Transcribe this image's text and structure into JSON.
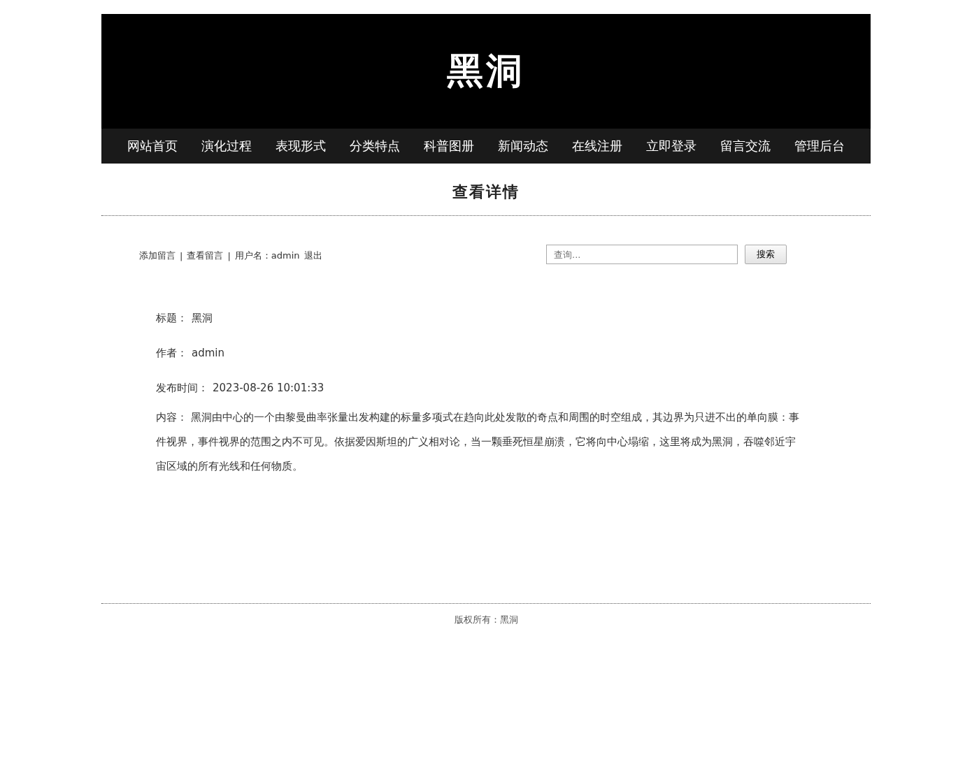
{
  "site_title": "黑洞",
  "nav": [
    {
      "label": "网站首页",
      "selected": false
    },
    {
      "label": "演化过程",
      "selected": false
    },
    {
      "label": "表现形式",
      "selected": false
    },
    {
      "label": "分类特点",
      "selected": false
    },
    {
      "label": "科普图册",
      "selected": false
    },
    {
      "label": "新闻动态",
      "selected": false
    },
    {
      "label": "在线注册",
      "selected": false
    },
    {
      "label": "立即登录",
      "selected": false
    },
    {
      "label": "留言交流",
      "selected": false
    },
    {
      "label": "管理后台",
      "selected": false
    }
  ],
  "page_heading": "查看详情",
  "toolbar": {
    "links": [
      "添加留言",
      "查看留言"
    ],
    "separator": "|",
    "user_label": "用户名：admin",
    "logout": "退出"
  },
  "search": {
    "placeholder": "查询...",
    "button": "搜索"
  },
  "details": [
    {
      "label": "标题：",
      "value": "黑洞"
    },
    {
      "label": "作者：",
      "value": "admin"
    },
    {
      "label": "发布时间：",
      "value": "2023-08-26 10:01:33"
    }
  ],
  "content": {
    "label": "内容：",
    "value": "黑洞由中心的一个由黎曼曲率张量出发构建的标量多项式在趋向此处发散的奇点和周围的时空组成，其边界为只进不出的单向膜：事件视界，事件视界的范围之内不可见。依据爱因斯坦的广义相对论，当一颗垂死恒星崩溃，它将向中心塌缩，这里将成为黑洞，吞噬邻近宇宙区域的所有光线和任何物质。"
  },
  "footer": "版权所有：黑洞"
}
